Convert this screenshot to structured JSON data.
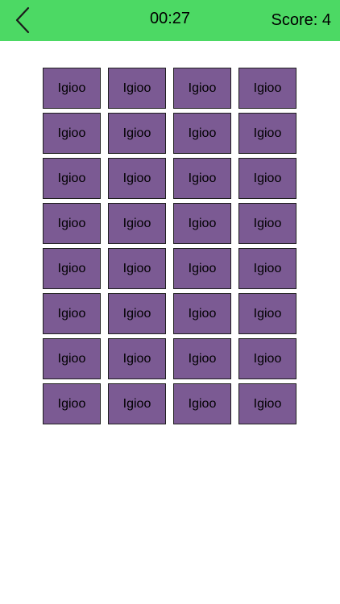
{
  "header": {
    "timer": "00:27",
    "score": "Score: 4",
    "back_icon": "chevron-left-icon"
  },
  "colors": {
    "header_bg": "#4cd964",
    "tile_bg": "#7b5a93",
    "tile_border": "#1f1f1f"
  },
  "grid": {
    "rows": [
      [
        "Igioo",
        "Igioo",
        "Igioo",
        "Igioo"
      ],
      [
        "Igioo",
        "Igioo",
        "Igioo",
        "Igioo"
      ],
      [
        "Igioo",
        "Igioo",
        "Igioo",
        "Igioo"
      ],
      [
        "Igioo",
        "Igioo",
        "Igioo",
        "Igioo"
      ],
      [
        "Igioo",
        "Igioo",
        "Igioo",
        "Igioo"
      ],
      [
        "Igioo",
        "Igioo",
        "Igioo",
        "Igioo"
      ],
      [
        "Igioo",
        "Igioo",
        "Igioo",
        "Igioo"
      ],
      [
        "Igioo",
        "Igioo",
        "Igioo",
        "Igioo"
      ]
    ]
  }
}
